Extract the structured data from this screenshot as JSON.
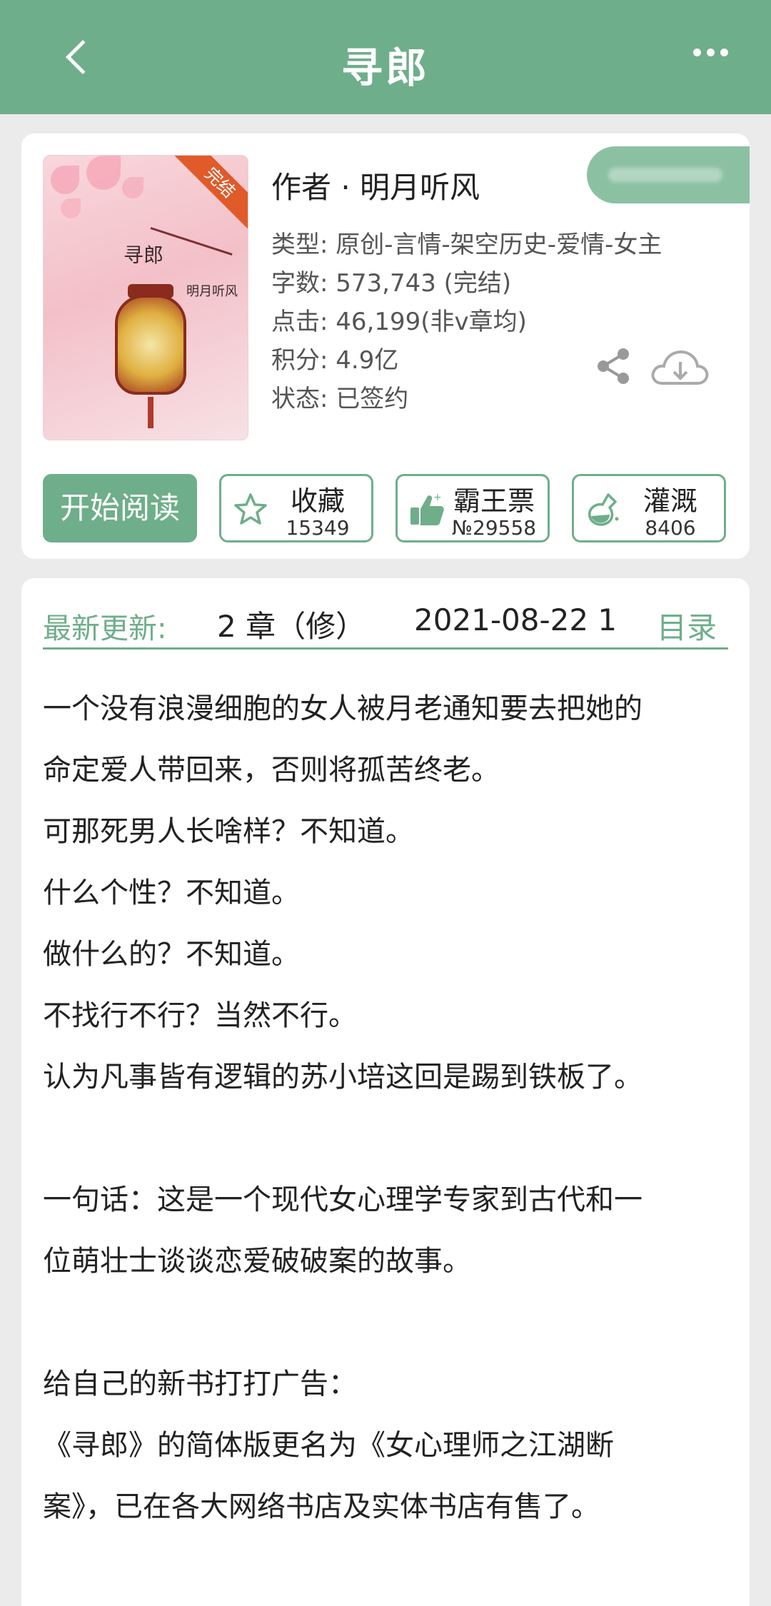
{
  "header": {
    "title": "寻郎"
  },
  "book": {
    "cover": {
      "title": "寻郎",
      "author": "明月听风",
      "badge": "完结"
    },
    "author_line": "作者 · 明月听风",
    "meta": [
      "类型: 原创-言情-架空历史-爱情-女主",
      "字数: 573,743 (完结)",
      "点击: 46,199(非v章均)",
      "积分: 4.9亿",
      "状态: 已签约"
    ]
  },
  "actions": {
    "read_label": "开始阅读",
    "collect": {
      "label": "收藏",
      "count": "15349"
    },
    "vote": {
      "label": "霸王票",
      "count": "№29558"
    },
    "water": {
      "label": "灌溉",
      "count": "8406"
    }
  },
  "update": {
    "label": "最新更新:",
    "chapter": "2 章（修）",
    "date": "2021-08-22 1",
    "toc_label": "目录"
  },
  "description": [
    "一个没有浪漫细胞的女人被月老通知要去把她的",
    "命定爱人带回来，否则将孤苦终老。",
    "可那死男人长啥样？不知道。",
    "什么个性？不知道。",
    "做什么的？不知道。",
    "不找行不行？当然不行。",
    "认为凡事皆有逻辑的苏小培这回是踢到铁板了。",
    "",
    "一句话：这是一个现代女心理学专家到古代和一",
    "位萌壮士谈谈恋爱破破案的故事。",
    "",
    "给自己的新书打打广告：",
    "《寻郎》的简体版更名为《女心理师之江湖断",
    "案》，已在各大网络书店及实体书店有售了。"
  ],
  "colors": {
    "accent": "#6fae8a",
    "background": "#ebebeb",
    "badge": "#e05a2a"
  }
}
